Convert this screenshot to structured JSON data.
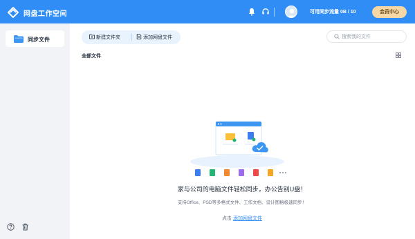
{
  "header": {
    "app_title": "网盘工作空间",
    "icons": [
      "bell-icon",
      "headset-icon"
    ],
    "quota_label": "可用同步流量 0B / 10",
    "member_button": "会员中心"
  },
  "sidebar": {
    "items": [
      {
        "label": "同步文件",
        "icon": "folder-icon",
        "active": true
      }
    ],
    "bottom_icons": [
      "help-icon",
      "trash-icon"
    ]
  },
  "toolbar": {
    "new_folder": "新建文件夹",
    "add_cloud_file": "添加网盘文件"
  },
  "search": {
    "placeholder": "搜索我的文件",
    "value": ""
  },
  "main": {
    "section_title": "全部文件"
  },
  "empty_state": {
    "title": "家与公司的电脑文件轻松同步，办公告别U盘！",
    "description": "支持Office、PSD等多格式文件、工作文档、设计图稿极速同步！",
    "action_prefix": "点击",
    "action_link": "添加网盘文件"
  },
  "colors": {
    "accent": "#2f8df5",
    "member_button_bg": "#f7d7a6"
  }
}
